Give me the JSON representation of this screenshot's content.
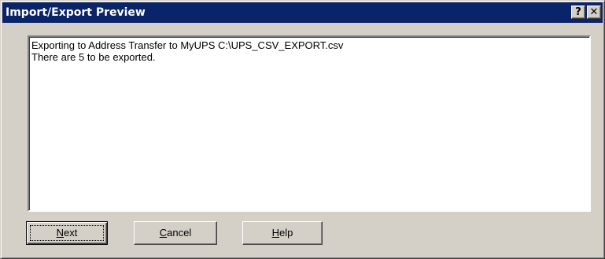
{
  "window": {
    "title": "Import/Export Preview",
    "help_caption": "?",
    "close_caption": "✕"
  },
  "preview": {
    "lines": [
      "Exporting to Address Transfer to MyUPS C:\\UPS_CSV_EXPORT.csv",
      "There are 5 to be exported."
    ]
  },
  "buttons": {
    "next": {
      "mnemonic": "N",
      "rest": "ext"
    },
    "cancel": {
      "mnemonic": "C",
      "rest": "ancel"
    },
    "help": {
      "mnemonic": "H",
      "rest": "elp"
    }
  },
  "colors": {
    "titlebar": "#0a246a",
    "face": "#d4d0c8"
  }
}
